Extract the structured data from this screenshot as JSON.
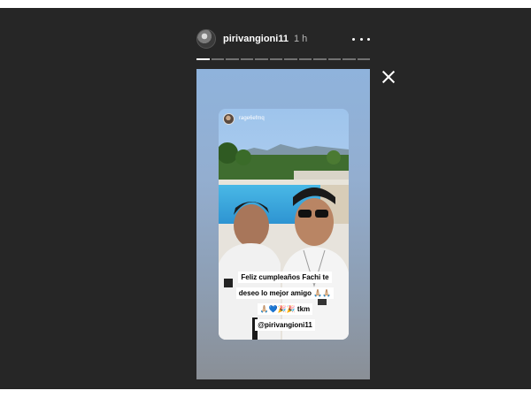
{
  "header": {
    "username": "pirivangioni11",
    "time": "1 h",
    "more_icon": "more-horizontal-icon",
    "close_icon": "close-icon"
  },
  "progress": {
    "segments": 12,
    "active_index": 0
  },
  "shared_post": {
    "username": "rage6efmq",
    "caption_lines": [
      "Feliz cumpleaños Fachi te",
      "deseo lo mejor amigo 🙏🏼🙏🏼",
      "🙏🏼💙🎉🎉 tkm",
      "@pirivangioni11"
    ]
  },
  "colors": {
    "background": "#262626",
    "page": "#ffffff",
    "text": "#ffffff"
  }
}
